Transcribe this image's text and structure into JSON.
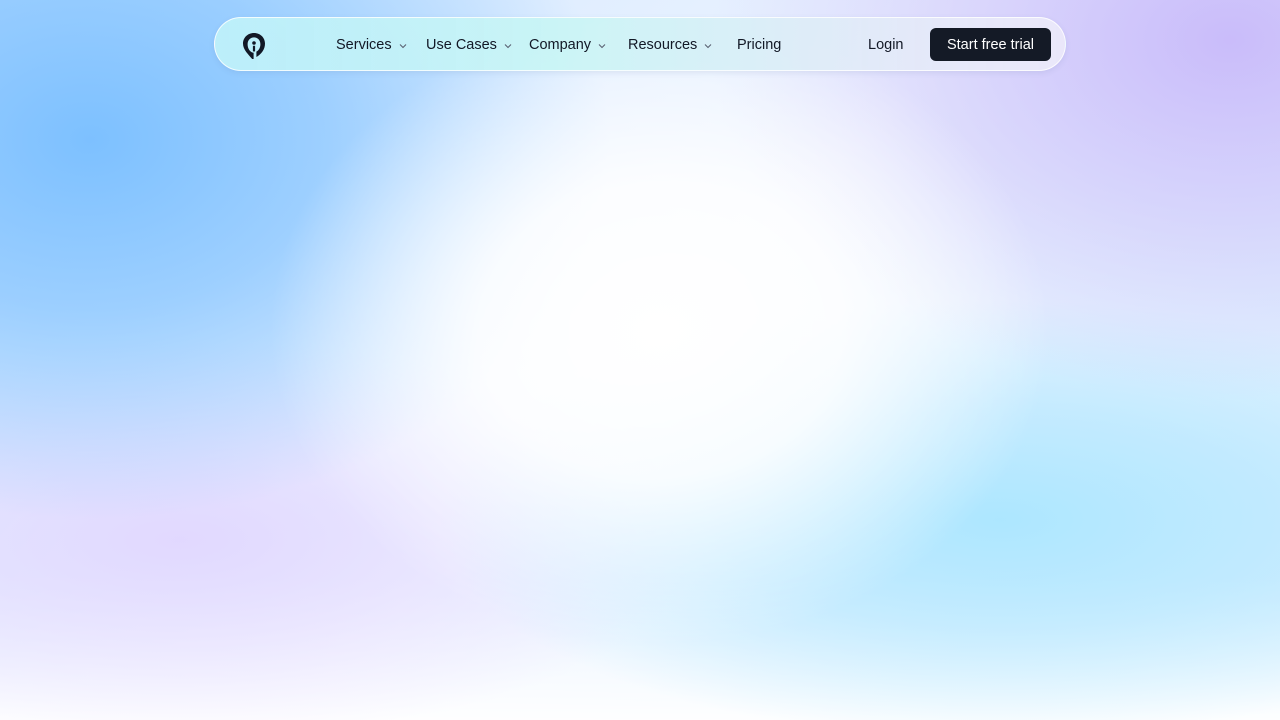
{
  "header": {
    "logo_icon": "pin-logo-icon",
    "nav": [
      {
        "label": "Services",
        "icon": "chevron-down-icon"
      },
      {
        "label": "Use Cases",
        "icon": "chevron-down-icon"
      },
      {
        "label": "Company",
        "icon": "chevron-down-icon"
      },
      {
        "label": "Resources",
        "icon": "chevron-down-icon"
      },
      {
        "label": "Pricing"
      }
    ],
    "login_label": "Login",
    "cta_label": "Start free trial"
  },
  "colors": {
    "cta_background": "#141a26",
    "text": "#121826"
  }
}
